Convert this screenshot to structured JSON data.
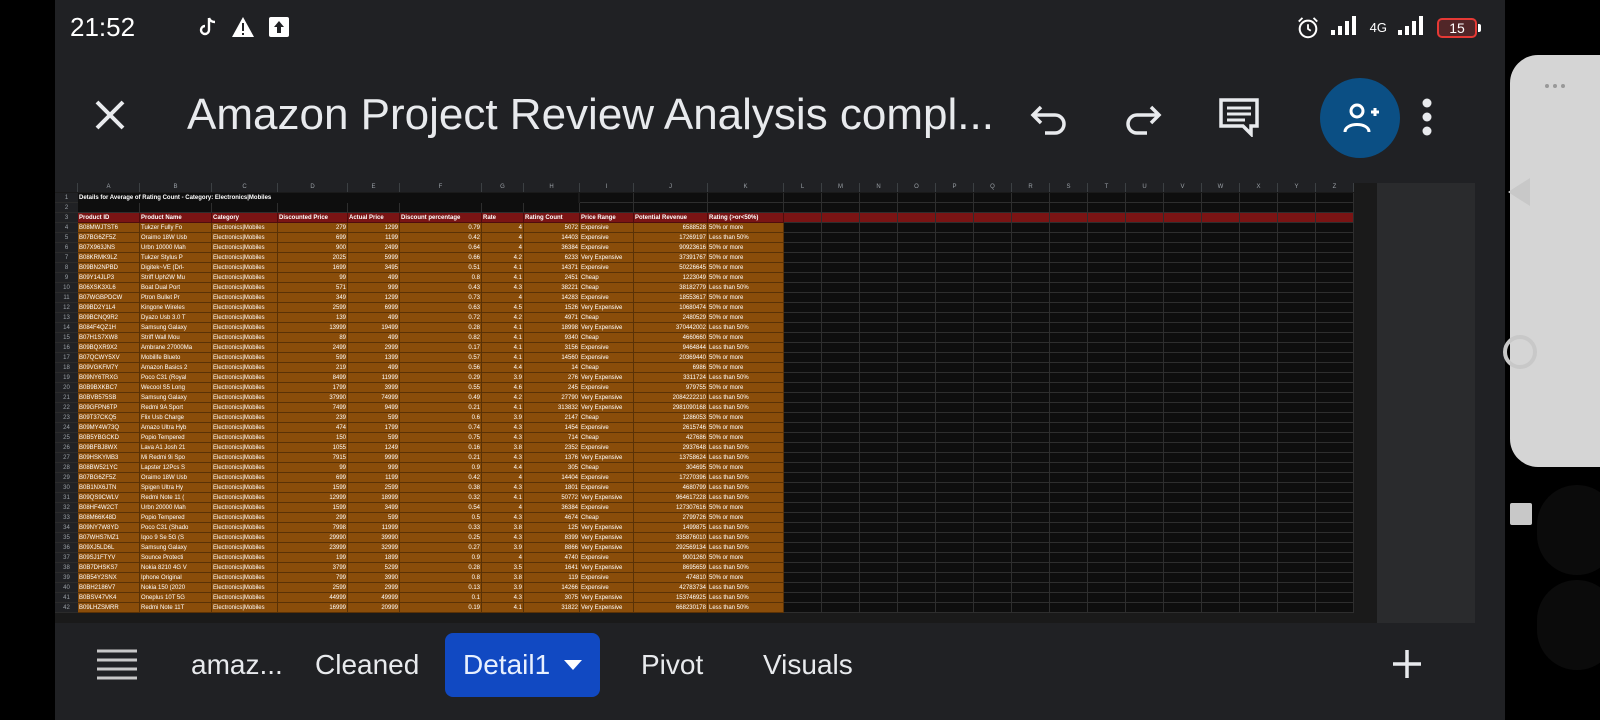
{
  "status": {
    "time": "21:52",
    "network": "4G",
    "battery": "15"
  },
  "appbar": {
    "title": "Amazon Project Review Analysis compl...",
    "icons": [
      "close-icon",
      "undo-icon",
      "redo-icon",
      "comment-icon",
      "add-person-icon",
      "more-vert-icon"
    ]
  },
  "sheet": {
    "columns": [
      "A",
      "B",
      "C",
      "D",
      "E",
      "F",
      "G",
      "H",
      "I",
      "J",
      "K",
      "L",
      "M",
      "N",
      "O",
      "P",
      "Q",
      "R",
      "S",
      "T",
      "U",
      "V",
      "W",
      "X",
      "Y",
      "Z"
    ],
    "title_row": "Details for Average of Rating Count - Category: Electronics|Mobiles",
    "headers": [
      "Product ID",
      "Product Name",
      "Category",
      "Discounted Price",
      "Actual Price",
      "Discount percentage",
      "Rate",
      "Rating Count",
      "Price Range",
      "Potential Revenue",
      "Rating (>or<50%)"
    ],
    "colors": {
      "header_bg": "#7a1414",
      "row_bg": "#8a4d0a",
      "text": "#ffffff"
    },
    "rows": [
      [
        "B08MWJTST6",
        "Tukzer Fully Fo",
        "Electronics|Mobiles",
        "279",
        "1299",
        "0.79",
        "4",
        "5072",
        "Expensive",
        "6588528",
        "50% or more"
      ],
      [
        "B07BG6ZF5Z",
        "Oraimo 18W Usb",
        "Electronics|Mobiles",
        "699",
        "1199",
        "0.42",
        "4",
        "14403",
        "Expensive",
        "17269197",
        "Less than 50%"
      ],
      [
        "B07X963JNS",
        "Urbn 10000 Mah",
        "Electronics|Mobiles",
        "900",
        "2499",
        "0.64",
        "4",
        "36384",
        "Expensive",
        "90923616",
        "50% or more"
      ],
      [
        "B08KRMK9LZ",
        "Tukzer Stylus P",
        "Electronics|Mobiles",
        "2025",
        "5999",
        "0.66",
        "4.2",
        "6233",
        "Very Expensive",
        "37391767",
        "50% or more"
      ],
      [
        "B09BN2NPBD",
        "Digitek~VE (Drl-",
        "Electronics|Mobiles",
        "1699",
        "3495",
        "0.51",
        "4.1",
        "14371",
        "Expensive",
        "50226645",
        "50% or more"
      ],
      [
        "B09Y14JLP3",
        "Striff Uph2W Mu",
        "Electronics|Mobiles",
        "99",
        "499",
        "0.8",
        "4.1",
        "2451",
        "Cheap",
        "1223049",
        "50% or more"
      ],
      [
        "B06XSK3XL6",
        "Boat Dual Port",
        "Electronics|Mobiles",
        "571",
        "999",
        "0.43",
        "4.3",
        "38221",
        "Cheap",
        "38182779",
        "Less than 50%"
      ],
      [
        "B07WGBPDCW",
        "Ptron Bullet Pr",
        "Electronics|Mobiles",
        "349",
        "1299",
        "0.73",
        "4",
        "14283",
        "Expensive",
        "18553617",
        "50% or more"
      ],
      [
        "B09BD2Y1L4",
        "Kingone Wireles",
        "Electronics|Mobiles",
        "2599",
        "6999",
        "0.63",
        "4.5",
        "1526",
        "Very Expensive",
        "10680474",
        "50% or more"
      ],
      [
        "B09BCNQ9R2",
        "Dyazo Usb 3.0 T",
        "Electronics|Mobiles",
        "139",
        "499",
        "0.72",
        "4.2",
        "4971",
        "Cheap",
        "2480529",
        "50% or more"
      ],
      [
        "B084F4QZ1H",
        "Samsung Galaxy",
        "Electronics|Mobiles",
        "13999",
        "19499",
        "0.28",
        "4.1",
        "18998",
        "Very Expensive",
        "370442002",
        "Less than 50%"
      ],
      [
        "B07H1S7XW8",
        "Striff Wall Mou",
        "Electronics|Mobiles",
        "89",
        "499",
        "0.82",
        "4.1",
        "9340",
        "Cheap",
        "4660660",
        "50% or more"
      ],
      [
        "B09BQXR9X2",
        "Ambrane 27000Ma",
        "Electronics|Mobiles",
        "2499",
        "2999",
        "0.17",
        "4.1",
        "3156",
        "Expensive",
        "9464844",
        "Less than 50%"
      ],
      [
        "B07QCWY5XV",
        "Mobilife Blueto",
        "Electronics|Mobiles",
        "599",
        "1399",
        "0.57",
        "4.1",
        "14560",
        "Expensive",
        "20369440",
        "50% or more"
      ],
      [
        "B09VGKFM7Y",
        "Amazon Basics 2",
        "Electronics|Mobiles",
        "219",
        "499",
        "0.56",
        "4.4",
        "14",
        "Cheap",
        "6986",
        "50% or more"
      ],
      [
        "B09NY6TRXG",
        "Poco C31 (Royal",
        "Electronics|Mobiles",
        "8499",
        "11999",
        "0.29",
        "3.9",
        "276",
        "Very Expensive",
        "3311724",
        "Less than 50%"
      ],
      [
        "B0B9BXKBC7",
        "Wecool S5 Long",
        "Electronics|Mobiles",
        "1799",
        "3999",
        "0.55",
        "4.6",
        "245",
        "Expensive",
        "979755",
        "50% or more"
      ],
      [
        "B0BVB575SB",
        "Samsung Galaxy",
        "Electronics|Mobiles",
        "37990",
        "74999",
        "0.49",
        "4.2",
        "27790",
        "Very Expensive",
        "2084222210",
        "Less than 50%"
      ],
      [
        "B09GFPN6TP",
        "Redmi 9A Sport",
        "Electronics|Mobiles",
        "7499",
        "9499",
        "0.21",
        "4.1",
        "313832",
        "Very Expensive",
        "2981090168",
        "Less than 50%"
      ],
      [
        "B09T37CKQ5",
        "Flix Usb Charge",
        "Electronics|Mobiles",
        "239",
        "599",
        "0.6",
        "3.9",
        "2147",
        "Cheap",
        "1286053",
        "50% or more"
      ],
      [
        "B09MY4W73Q",
        "Amazo Ultra Hyb",
        "Electronics|Mobiles",
        "474",
        "1799",
        "0.74",
        "4.3",
        "1454",
        "Expensive",
        "2615746",
        "50% or more"
      ],
      [
        "B0B5YBGCKD",
        "Popio Tempered",
        "Electronics|Mobiles",
        "150",
        "599",
        "0.75",
        "4.3",
        "714",
        "Cheap",
        "427686",
        "50% or more"
      ],
      [
        "B09BFBJ8WX",
        "Lava A1 Josh 21",
        "Electronics|Mobiles",
        "1055",
        "1249",
        "0.16",
        "3.8",
        "2352",
        "Expensive",
        "2937648",
        "Less than 50%"
      ],
      [
        "B09HSKYMB3",
        "Mi Redmi 9i Spo",
        "Electronics|Mobiles",
        "7915",
        "9999",
        "0.21",
        "4.3",
        "1376",
        "Very Expensive",
        "13758624",
        "Less than 50%"
      ],
      [
        "B08BW521YC",
        "Lapster 12Pcs S",
        "Electronics|Mobiles",
        "99",
        "999",
        "0.9",
        "4.4",
        "305",
        "Cheap",
        "304695",
        "50% or more"
      ],
      [
        "B07BG6ZF5Z",
        "Oraimo 18W Usb",
        "Electronics|Mobiles",
        "699",
        "1199",
        "0.42",
        "4",
        "14404",
        "Expensive",
        "17270396",
        "Less than 50%"
      ],
      [
        "B0B1NX6JTN",
        "Spigen Ultra Hy",
        "Electronics|Mobiles",
        "1599",
        "2599",
        "0.38",
        "4.3",
        "1801",
        "Expensive",
        "4680799",
        "Less than 50%"
      ],
      [
        "B09QS9CWLV",
        "Redmi Note 11 (",
        "Electronics|Mobiles",
        "12999",
        "18999",
        "0.32",
        "4.1",
        "50772",
        "Very Expensive",
        "964617228",
        "Less than 50%"
      ],
      [
        "B08HF4W2CT",
        "Urbn 20000 Mah",
        "Electronics|Mobiles",
        "1599",
        "3499",
        "0.54",
        "4",
        "36384",
        "Expensive",
        "127307616",
        "50% or more"
      ],
      [
        "B08M66K48D",
        "Popio Tempered",
        "Electronics|Mobiles",
        "299",
        "599",
        "0.5",
        "4.3",
        "4674",
        "Cheap",
        "2799726",
        "50% or more"
      ],
      [
        "B09NY7W8YD",
        "Poco C31 (Shado",
        "Electronics|Mobiles",
        "7998",
        "11999",
        "0.33",
        "3.8",
        "125",
        "Very Expensive",
        "1499875",
        "Less than 50%"
      ],
      [
        "B07WHS7MZ1",
        "Iqoo 9 Se 5G (S",
        "Electronics|Mobiles",
        "29990",
        "39990",
        "0.25",
        "4.3",
        "8399",
        "Very Expensive",
        "335876010",
        "Less than 50%"
      ],
      [
        "B09XJ5LD6L",
        "Samsung Galaxy",
        "Electronics|Mobiles",
        "23999",
        "32999",
        "0.27",
        "3.9",
        "8866",
        "Very Expensive",
        "292569134",
        "Less than 50%"
      ],
      [
        "B09SJ1FTYV",
        "Sounce Protecti",
        "Electronics|Mobiles",
        "199",
        "1899",
        "0.9",
        "4",
        "4740",
        "Expensive",
        "9001260",
        "50% or more"
      ],
      [
        "B0B7DHSKS7",
        "Nokia 8210 4G V",
        "Electronics|Mobiles",
        "3799",
        "5299",
        "0.28",
        "3.5",
        "1641",
        "Very Expensive",
        "8695659",
        "Less than 50%"
      ],
      [
        "B0B54Y2SNX",
        "Iphone Original",
        "Electronics|Mobiles",
        "799",
        "3990",
        "0.8",
        "3.8",
        "119",
        "Expensive",
        "474810",
        "50% or more"
      ],
      [
        "B0BH2186V7",
        "Nokia 150 (2020",
        "Electronics|Mobiles",
        "2599",
        "2999",
        "0.13",
        "3.9",
        "14266",
        "Expensive",
        "42783734",
        "Less than 50%"
      ],
      [
        "B0BSV47VK4",
        "Oneplus 10T 5G",
        "Electronics|Mobiles",
        "44999",
        "49999",
        "0.1",
        "4.3",
        "3075",
        "Very Expensive",
        "153746925",
        "Less than 50%"
      ],
      [
        "B09LHZSMRR",
        "Redmi Note 11T",
        "Electronics|Mobiles",
        "16999",
        "20999",
        "0.19",
        "4.1",
        "31822",
        "Very Expensive",
        "668230178",
        "Less than 50%"
      ]
    ]
  },
  "tabs": {
    "items": [
      {
        "label": "amaz...",
        "active": false
      },
      {
        "label": "Cleaned",
        "active": false
      },
      {
        "label": "Detail1",
        "active": true
      },
      {
        "label": "Pivot",
        "active": false
      },
      {
        "label": "Visuals",
        "active": false
      }
    ],
    "icons": [
      "sheet-list-icon",
      "add-sheet-icon"
    ]
  }
}
